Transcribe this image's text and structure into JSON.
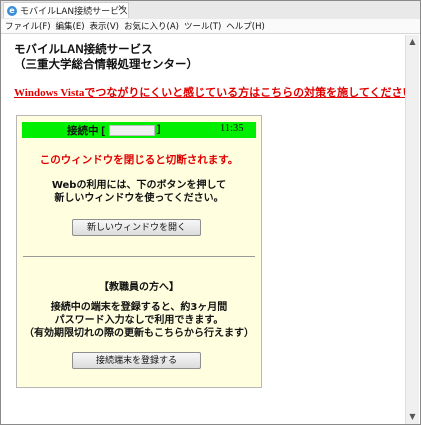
{
  "tab": {
    "title": "モバイルLAN接続サービス - ...",
    "close": "✕"
  },
  "menu": {
    "items": [
      "ファイル(F)",
      "編集(E)",
      "表示(V)",
      "お気に入り(A)",
      "ツール(T)",
      "ヘルプ(H)"
    ]
  },
  "page": {
    "title_line1": "モバイルLAN接続サービス",
    "title_line2": "（三重大学総合情報処理センター）",
    "vista_link": "Windows Vistaでつながりにくいと感じている方はこちらの対策を施してください。"
  },
  "panel": {
    "status_label": "接続中 [",
    "status_bracket": "]",
    "status_time": "11:35",
    "warning": "このウィンドウを閉じると切断されます。",
    "info_line1": "Webの利用には、下のボタンを押して",
    "info_line2": "新しいウィンドウを使ってください。",
    "open_button": "新しいウィンドウを開く",
    "staff_heading": "【教職員の方へ】",
    "staff_line1": "接続中の端末を登録すると、約3ヶ月間",
    "staff_line2": "パスワード入力なしで利用できます。",
    "staff_line3": "（有効期限切れの際の更新もこちらから行えます）",
    "register_button": "接続端末を登録する"
  },
  "scrollbar": {
    "up": "▲",
    "down": "▼"
  },
  "colors": {
    "status_bg": "#00ee00",
    "panel_bg": "#ffffe0",
    "warning": "#e00000"
  }
}
